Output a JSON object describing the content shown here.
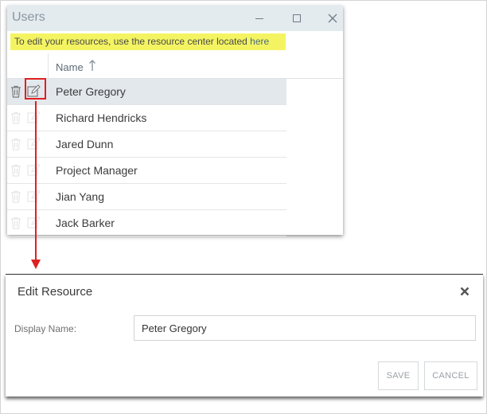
{
  "users_window": {
    "title": "Users",
    "controls": [
      "minimize",
      "maximize",
      "close"
    ],
    "info_banner": {
      "text": "To edit your resources, use the resource center located ",
      "link": "here"
    },
    "columns": {
      "name": "Name",
      "sort": "ascending"
    },
    "rows": [
      {
        "name": "Peter Gregory",
        "selected": true
      },
      {
        "name": "Richard Hendricks",
        "selected": false
      },
      {
        "name": "Jared Dunn",
        "selected": false
      },
      {
        "name": "Project Manager",
        "selected": false
      },
      {
        "name": "Jian Yang",
        "selected": false
      },
      {
        "name": "Jack Barker",
        "selected": false
      }
    ]
  },
  "edit_panel": {
    "title": "Edit Resource",
    "display_name_label": "Display Name:",
    "display_name_value": "Peter Gregory",
    "save_label": "SAVE",
    "cancel_label": "CANCEL"
  },
  "colors": {
    "annotation_red": "#e02020",
    "banner_yellow": "#f4f462",
    "titlebar_bg": "#e3ebef",
    "selected_row_bg": "#e3e8ec"
  }
}
